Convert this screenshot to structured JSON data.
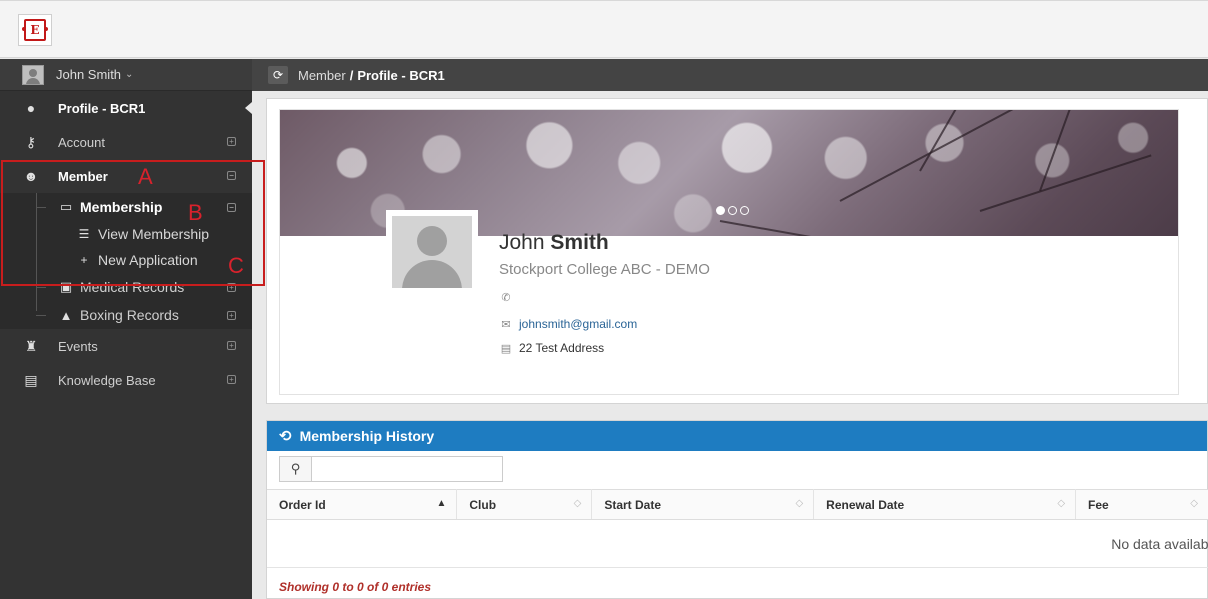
{
  "app": {
    "logo_icon": "club-crest-logo",
    "brand_color": "#c21818"
  },
  "sidebar": {
    "user_name": "John Smith",
    "items": [
      {
        "label": "Profile - BCR1",
        "icon": "user-icon"
      },
      {
        "label": "Account",
        "icon": "key-icon"
      },
      {
        "label": "Member",
        "icon": "users-icon"
      },
      {
        "label": "Events",
        "icon": "trophy-icon"
      },
      {
        "label": "Knowledge Base",
        "icon": "book-icon"
      }
    ],
    "member_sub": [
      {
        "label": "Membership",
        "icon": "card-icon"
      },
      {
        "label": "Medical Records",
        "icon": "medkit-icon"
      },
      {
        "label": "Boxing Records",
        "icon": "bell-icon"
      }
    ],
    "membership_sub": [
      {
        "label": "View Membership",
        "icon": "list-icon"
      },
      {
        "label": "New Application",
        "icon": "plus-icon"
      }
    ]
  },
  "annotations": {
    "a": "A",
    "b": "B",
    "c": "C",
    "color": "#c81d1d"
  },
  "breadcrumb": {
    "parent": "Member",
    "separator": "/",
    "current": "Profile - BCR1"
  },
  "profile": {
    "first_name": "John",
    "last_name": "Smith",
    "college": "Stockport College ABC - DEMO",
    "phone": "",
    "email": "johnsmith@gmail.com",
    "address": "22 Test Address",
    "carousel_active_index": 0,
    "carousel_count": 3
  },
  "history": {
    "title": "Membership History",
    "search_placeholder": "",
    "columns": [
      "Order Id",
      "Club",
      "Start Date",
      "Renewal Date",
      "Fee"
    ],
    "empty_text": "No data availab",
    "footer": "Showing 0 to 0 of 0 entries",
    "header_color": "#1e7cc1"
  }
}
